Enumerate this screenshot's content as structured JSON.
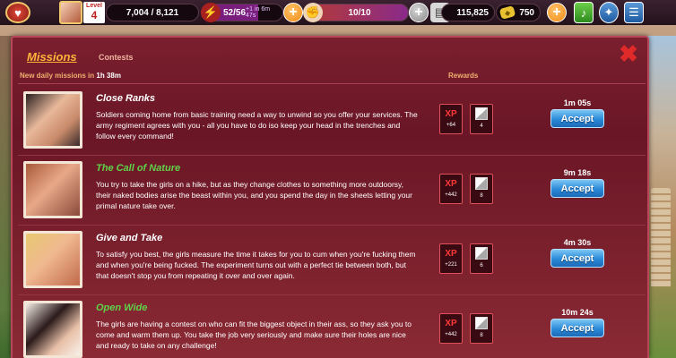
{
  "topbar": {
    "level_label": "Level",
    "level": "4",
    "xp_progress": "7,004 / 8,121",
    "energy": "52/56",
    "energy_timer": "+1 in 6m 47s",
    "fists": "10/10",
    "money": "115,825",
    "kobans": "750"
  },
  "missions_panel": {
    "tab_missions": "Missions",
    "tab_contests": "Contests",
    "new_daily_label": "New daily missions in",
    "new_daily_timer": "1h 38m",
    "rewards_label": "Rewards",
    "accept_label": "Accept",
    "xp_label": "XP",
    "missions": [
      {
        "title": "Close Ranks",
        "description": "Soldiers coming home from basic training need a way to unwind so you offer your services. The army regiment agrees with you - all you have to do iso keep your head in the trenches and follow every command!",
        "xp": "+64",
        "item_count": "4",
        "time": "1m 05s"
      },
      {
        "title": "The Call of Nature",
        "description": "You try to take the girls on a hike, but as they change clothes to something more outdoorsy, their naked bodies arise the beast within you, and you spend the day in the sheets letting your primal nature take over.",
        "xp": "+442",
        "item_count": "8",
        "time": "9m 18s"
      },
      {
        "title": "Give and Take",
        "description": "To satisfy you best, the girls measure the time it takes for you to cum when you're fucking them and when you're being fucked. The experiment turns out with a perfect tie between both, but that doesn't stop you from repeating it over and over again.",
        "xp": "+221",
        "item_count": "6",
        "time": "4m 30s"
      },
      {
        "title": "Open Wide",
        "description": "The girls are having a contest on who can fit the biggest object in their ass, so they ask you to come and warm them up. You take the job very seriously and make sure their holes are nice and ready to take on any challenge!",
        "xp": "+442",
        "item_count": "8",
        "time": "10m 24s"
      }
    ]
  }
}
